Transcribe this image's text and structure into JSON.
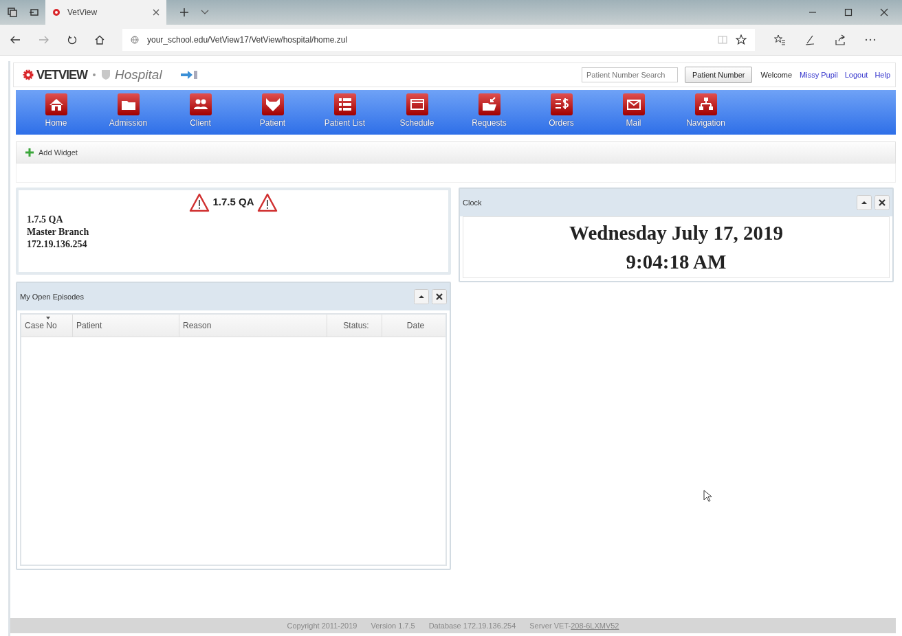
{
  "browser": {
    "tabs": [
      {
        "title": "VetView",
        "selected": true
      }
    ],
    "url": "your_school.edu/VetView17/VetView/hospital/home.zul"
  },
  "header": {
    "logo": "VETVIEW",
    "module": "Hospital",
    "search": {
      "placeholder": "Patient Number Search"
    },
    "search_button": "Patient Number",
    "welcome": "Welcome",
    "user": "Missy Pupil",
    "links": [
      "Logout",
      "Help"
    ]
  },
  "nav": [
    {
      "label": "Home",
      "kind": "home"
    },
    {
      "label": "Admission",
      "kind": "folder"
    },
    {
      "label": "Client",
      "kind": "people"
    },
    {
      "label": "Patient",
      "kind": "animal"
    },
    {
      "label": "Patient List",
      "kind": "list"
    },
    {
      "label": "Schedule",
      "kind": "calendar"
    },
    {
      "label": "Requests",
      "kind": "inbox"
    },
    {
      "label": "Orders",
      "kind": "orders"
    },
    {
      "label": "Mail",
      "kind": "mail"
    },
    {
      "label": "Navigation",
      "kind": "sitemap"
    }
  ],
  "toolbar": {
    "add_widget": "Add Widget"
  },
  "info_widget": {
    "title": "1.7.5 QA",
    "lines": [
      "1.7.5 QA",
      "Master Branch",
      "172.19.136.254"
    ]
  },
  "episodes_widget": {
    "title": "My Open Episodes",
    "columns": [
      {
        "label": "Case No",
        "sorted": true
      },
      {
        "label": "Patient",
        "sorted": false
      },
      {
        "label": "Reason",
        "sorted": false
      },
      {
        "label": "Status:",
        "sorted": false
      },
      {
        "label": "Date",
        "sorted": false
      }
    ]
  },
  "clock_widget": {
    "title": "Clock",
    "date": "Wednesday July 17, 2019",
    "time": "9:04:18 AM"
  },
  "footer": {
    "copyright": "Copyright 2011-2019",
    "version": "Version 1.7.5",
    "database": "Database 172.19.136.254",
    "server": "Server VET-",
    "server_link": "208-6LXMV52"
  }
}
